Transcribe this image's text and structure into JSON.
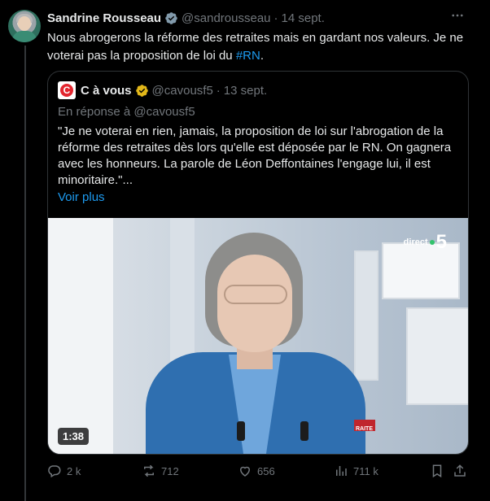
{
  "tweet": {
    "author_name": "Sandrine Rousseau",
    "author_handle": "@sandrousseau",
    "separator": "·",
    "date": "14 sept.",
    "text_main": "Nous abrogerons la réforme des retraites mais en gardant nos valeurs. Je ne voterai pas la proposition de loi du ",
    "hashtag": "#RN",
    "text_end": "."
  },
  "quote": {
    "logo_letter": "C",
    "name": "C à vous",
    "handle": "@cavousf5",
    "separator": "·",
    "date": "13 sept.",
    "reply_to": "En réponse à @cavousf5",
    "text": "\"Je ne voterai en rien, jamais, la proposition de loi sur l'abrogation de la réforme des retraites dès lors qu'elle est déposée par le RN. On gagnera avec les honneurs. La parole de Léon Deffontaines l'engage lui, il est minoritaire.\"...",
    "show_more": "Voir plus",
    "video": {
      "channel_prefix": "direct",
      "channel_number": "5",
      "duration": "1:38",
      "banner_text": "RAITE"
    }
  },
  "actions": {
    "replies": "2 k",
    "reposts": "712",
    "likes": "656",
    "views": "711 k"
  },
  "icons": {
    "verified": "verified-badge-icon",
    "gold_verified": "gold-verified-badge-icon",
    "more": "more-options-icon",
    "reply": "reply-icon",
    "repost": "repost-icon",
    "like": "like-icon",
    "views": "views-icon",
    "bookmark": "bookmark-icon",
    "share": "share-icon"
  },
  "colors": {
    "background": "#000000",
    "text": "#e7e9ea",
    "muted": "#71767b",
    "link": "#1d9bf0",
    "border": "#2f3336"
  }
}
